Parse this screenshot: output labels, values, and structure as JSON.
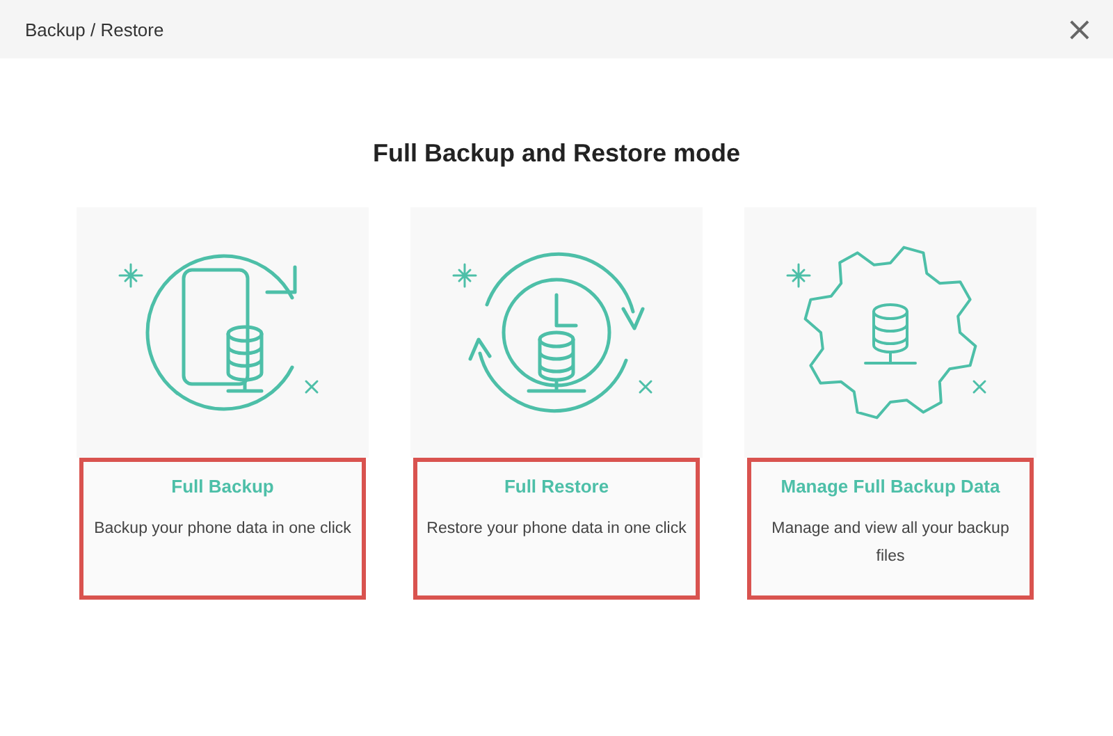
{
  "window": {
    "title": "Backup / Restore",
    "close": "×"
  },
  "heading": "Full Backup and Restore mode",
  "cards": [
    {
      "kind": "backup",
      "title": "Full Backup",
      "description": "Backup your phone data in one click",
      "highlighted": true
    },
    {
      "kind": "restore",
      "title": "Full Restore",
      "description": "Restore your phone data in one click",
      "highlighted": true
    },
    {
      "kind": "manage",
      "title": "Manage Full Backup Data",
      "description": "Manage and view all your backup files",
      "highlighted": true
    }
  ]
}
